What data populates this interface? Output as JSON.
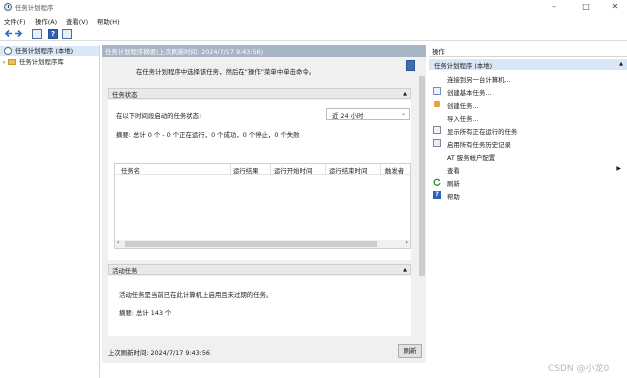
{
  "window": {
    "title": "任务计划程序",
    "minimize": "–",
    "maximize": "□",
    "close": "✕"
  },
  "menu": [
    "文件(F)",
    "操作(A)",
    "查看(V)",
    "帮助(H)"
  ],
  "toolbar": {
    "help_glyph": "?"
  },
  "tree": [
    {
      "label": "任务计划程序 (本地)",
      "expander": ""
    },
    {
      "label": "任务计划程序库",
      "expander": "›"
    }
  ],
  "middle": {
    "header": "任务计划程序摘要(上次刷新时间: 2024/7/17 9:43:56)",
    "hint": "在任务计划程序中选择该任务，然后在“操作”菜单中单击命令。",
    "status_section": {
      "title": "任务状态",
      "prompt": "在以下时间段启动的任务状态:",
      "period": "近 24 小时",
      "summary": "摘要: 总计 0 个 - 0 个正在运行，0 个成功，0 个停止，0 个失败",
      "columns": [
        "任务名",
        "运行结果",
        "运行开始时间",
        "运行结束时间",
        "触发者"
      ]
    },
    "active_section": {
      "title": "活动任务",
      "description": "活动任务是当前已在此计算机上启用且未过期的任务。",
      "summary": "摘要: 总计 143 个"
    },
    "last_refresh": "上次刷新时间: 2024/7/17 9:43:56",
    "refresh_button": "刷新"
  },
  "actions": {
    "header": "操作",
    "group": "任务计划程序 (本地)",
    "items": [
      {
        "label": "连接到另一台计算机...",
        "icon": "none"
      },
      {
        "label": "创建基本任务...",
        "icon": "create-basic-task-icon"
      },
      {
        "label": "创建任务...",
        "icon": "create-task-icon"
      },
      {
        "label": "导入任务...",
        "icon": "none"
      },
      {
        "label": "显示所有正在运行的任务",
        "icon": "running-tasks-icon"
      },
      {
        "label": "启用所有任务历史记录",
        "icon": "history-icon"
      },
      {
        "label": "AT 服务帐户配置",
        "icon": "none"
      },
      {
        "label": "查看",
        "icon": "none"
      },
      {
        "label": "刷新",
        "icon": "refresh-icon"
      },
      {
        "label": "帮助",
        "icon": "help-icon"
      }
    ]
  },
  "watermark": "CSDN @小龙0"
}
